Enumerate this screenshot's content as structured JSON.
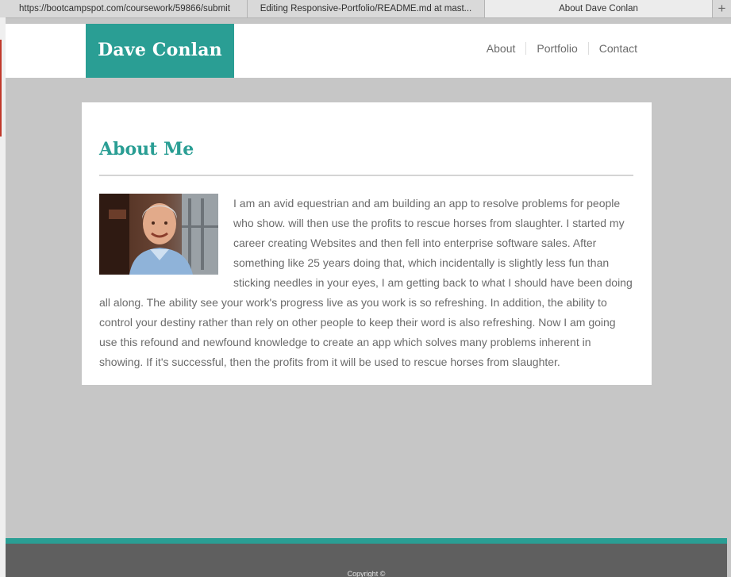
{
  "browser": {
    "tabs": [
      {
        "title": "https://bootcampspot.com/coursework/59866/submit"
      },
      {
        "title": "Editing Responsive-Portfolio/README.md at mast..."
      },
      {
        "title": "About Dave Conlan"
      }
    ],
    "new_tab_label": "+"
  },
  "header": {
    "brand": "Dave Conlan",
    "nav": [
      "About",
      "Portfolio",
      "Contact"
    ]
  },
  "main": {
    "heading": "About Me",
    "photo_alt": "Dave Conlan",
    "bio": "I am an avid equestrian and am building an app to resolve problems for people who show. will then use the profits to rescue horses from slaughter. I started my career creating Websites and then fell into enterprise software sales. After something like 25 years doing that, which incidentally is slightly less fun than sticking needles in your eyes, I am getting back to what I should have been doing all along. The ability see your work's progress live as you work is so refreshing. In addition, the ability to control your destiny rather than rely on other people to keep their word is also refreshing. Now I am going use this refound and newfound knowledge to create an app which solves many problems inherent in showing. If it's successful, then the profits from it will be used to rescue horses from slaughter."
  },
  "footer": {
    "copyright": "Copyright ©"
  },
  "colors": {
    "accent": "#2a9e94",
    "page_bg": "#c6c6c6",
    "footer_bg": "#5f5f5f",
    "text": "#6b6b6b"
  }
}
